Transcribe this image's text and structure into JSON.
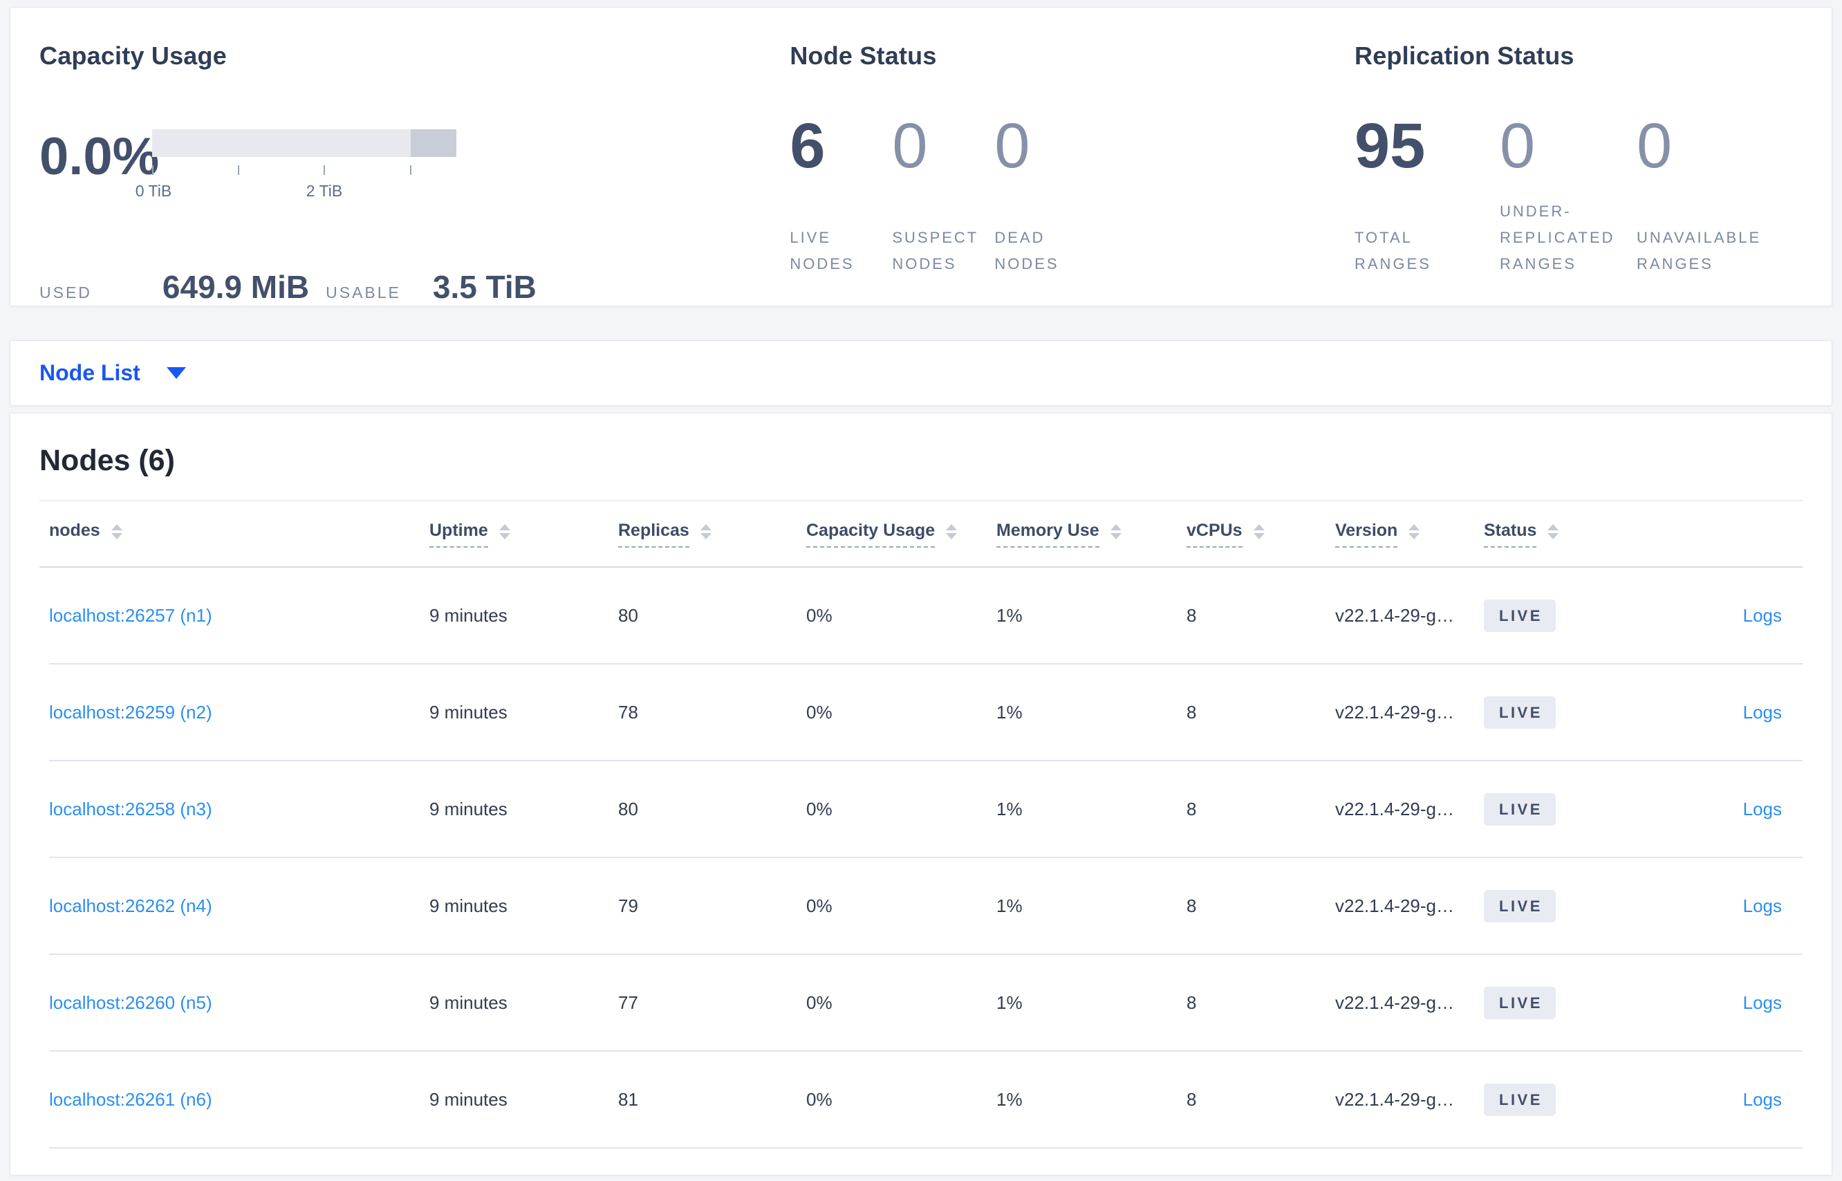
{
  "colors": {
    "selector_blue": "#1757f2",
    "link_blue": "#2a8ff2",
    "num_dark": "#43506b",
    "num_muted": "#8690a9",
    "badge_bg": "#e8ebf2",
    "badge_text": "#414e69",
    "bar_light": "#e7e9ee",
    "bar_dark": "#c9cdd7"
  },
  "summary": {
    "capacity": {
      "title": "Capacity Usage",
      "percent": "0.0%",
      "axis_ticks": [
        "0 TiB",
        "2 TiB"
      ],
      "used_label": "USED",
      "used_value": "649.9 MiB",
      "usable_label": "USABLE",
      "usable_value": "3.5 TiB"
    },
    "node_status": {
      "title": "Node Status",
      "stats": [
        {
          "value": "6",
          "label": "LIVE\nNODES"
        },
        {
          "value": "0",
          "label": "SUSPECT\nNODES"
        },
        {
          "value": "0",
          "label": "DEAD\nNODES"
        }
      ]
    },
    "replication": {
      "title": "Replication Status",
      "stats": [
        {
          "value": "95",
          "label": "TOTAL\nRANGES"
        },
        {
          "value": "0",
          "label": "UNDER-\nREPLICATED\nRANGES"
        },
        {
          "value": "0",
          "label": "UNAVAILABLE\nRANGES"
        }
      ]
    }
  },
  "view_selector": {
    "label": "Node List"
  },
  "nodes_table": {
    "title": "Nodes (6)",
    "columns": [
      {
        "label": "nodes"
      },
      {
        "label": "Uptime"
      },
      {
        "label": "Replicas"
      },
      {
        "label": "Capacity Usage"
      },
      {
        "label": "Memory Use"
      },
      {
        "label": "vCPUs"
      },
      {
        "label": "Version"
      },
      {
        "label": "Status"
      }
    ],
    "rows": [
      {
        "node": "localhost:26257 (n1)",
        "uptime": "9 minutes",
        "replicas": "80",
        "capacity": "0%",
        "memory": "1%",
        "vcpus": "8",
        "version": "v22.1.4-29-g…",
        "status": "LIVE",
        "logs": "Logs"
      },
      {
        "node": "localhost:26259 (n2)",
        "uptime": "9 minutes",
        "replicas": "78",
        "capacity": "0%",
        "memory": "1%",
        "vcpus": "8",
        "version": "v22.1.4-29-g…",
        "status": "LIVE",
        "logs": "Logs"
      },
      {
        "node": "localhost:26258 (n3)",
        "uptime": "9 minutes",
        "replicas": "80",
        "capacity": "0%",
        "memory": "1%",
        "vcpus": "8",
        "version": "v22.1.4-29-g…",
        "status": "LIVE",
        "logs": "Logs"
      },
      {
        "node": "localhost:26262 (n4)",
        "uptime": "9 minutes",
        "replicas": "79",
        "capacity": "0%",
        "memory": "1%",
        "vcpus": "8",
        "version": "v22.1.4-29-g…",
        "status": "LIVE",
        "logs": "Logs"
      },
      {
        "node": "localhost:26260 (n5)",
        "uptime": "9 minutes",
        "replicas": "77",
        "capacity": "0%",
        "memory": "1%",
        "vcpus": "8",
        "version": "v22.1.4-29-g…",
        "status": "LIVE",
        "logs": "Logs"
      },
      {
        "node": "localhost:26261 (n6)",
        "uptime": "9 minutes",
        "replicas": "81",
        "capacity": "0%",
        "memory": "1%",
        "vcpus": "8",
        "version": "v22.1.4-29-g…",
        "status": "LIVE",
        "logs": "Logs"
      }
    ]
  }
}
